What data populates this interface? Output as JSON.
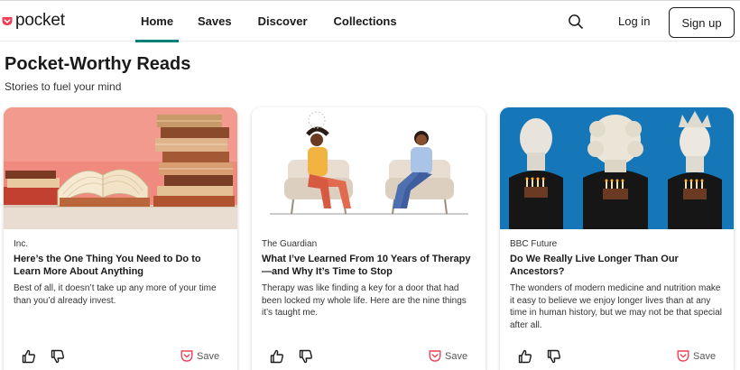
{
  "header": {
    "logo_text": "pocket",
    "nav": [
      {
        "label": "Home",
        "active": true
      },
      {
        "label": "Saves"
      },
      {
        "label": "Discover"
      },
      {
        "label": "Collections"
      }
    ],
    "search_icon": "search-icon",
    "login_label": "Log in",
    "signup_label": "Sign up"
  },
  "page": {
    "title": "Pocket-Worthy Reads",
    "subtitle": "Stories to fuel your mind"
  },
  "cards": [
    {
      "publisher": "Inc.",
      "title": "Here’s the One Thing You Need to Do to Learn More About Anything",
      "excerpt": "Best of all, it doesn’t take up any more of your time than you’d already invest.",
      "image": "stack-of-books"
    },
    {
      "publisher": "The Guardian",
      "title": "What I’ve Learned From 10 Years of Therapy—and Why It’s Time to Stop",
      "excerpt": "Therapy was like finding a key for a door that had been locked my whole life. Here are the nine things it’s taught me.",
      "image": "therapy-session-illustration"
    },
    {
      "publisher": "BBC Future",
      "title": "Do We Really Live Longer Than Our Ancestors?",
      "excerpt": "The wonders of modern medicine and nutrition make it easy to believe we enjoy longer lives than at any time in human history, but we may not be that special after all.",
      "image": "busts-with-birthday-cakes"
    }
  ],
  "card_actions": {
    "save_label": "Save",
    "like_icon": "thumbs-up-icon",
    "dislike_icon": "thumbs-down-icon",
    "save_icon": "pocket-save-icon"
  },
  "colors": {
    "brand": "#ef4056",
    "accent": "#008078",
    "text": "#1a1a1a"
  }
}
